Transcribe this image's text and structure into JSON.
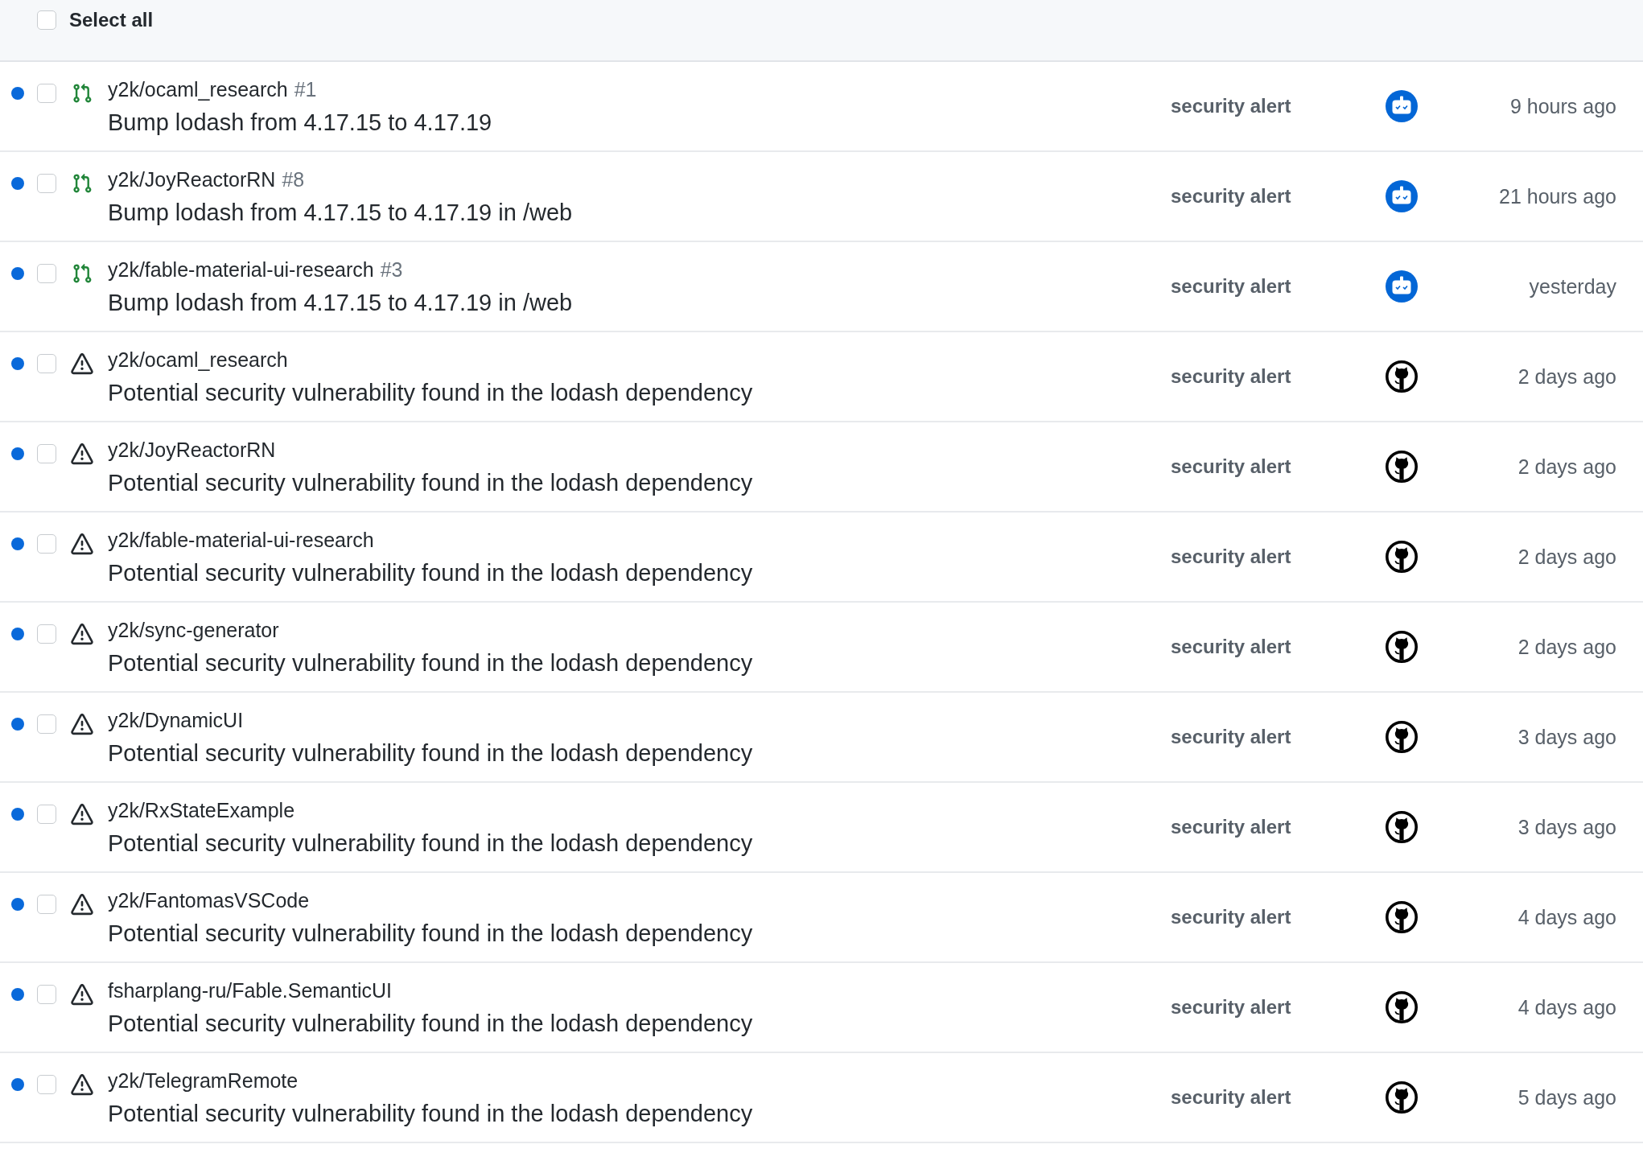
{
  "header": {
    "select_all": {
      "label": "Select all",
      "checked": false
    }
  },
  "notifications": [
    {
      "kind": "pull-request",
      "unread": true,
      "checked": false,
      "repo": "y2k/ocaml_research",
      "number": "#1",
      "title": "Bump lodash from 4.17.15 to 4.17.19",
      "reason": "security alert",
      "avatar": {
        "kind": "robot"
      },
      "time": "9 hours ago"
    },
    {
      "kind": "pull-request",
      "unread": true,
      "checked": false,
      "repo": "y2k/JoyReactorRN",
      "number": "#8",
      "title": "Bump lodash from 4.17.15 to 4.17.19 in /web",
      "reason": "security alert",
      "avatar": {
        "kind": "robot"
      },
      "time": "21 hours ago"
    },
    {
      "kind": "pull-request",
      "unread": true,
      "checked": false,
      "repo": "y2k/fable-material-ui-research",
      "number": "#3",
      "title": "Bump lodash from 4.17.15 to 4.17.19 in /web",
      "reason": "security alert",
      "avatar": {
        "kind": "robot"
      },
      "time": "yesterday"
    },
    {
      "kind": "alert",
      "unread": true,
      "checked": false,
      "repo": "y2k/ocaml_research",
      "title": "Potential security vulnerability found in the lodash dependency",
      "reason": "security alert",
      "avatar": {
        "kind": "cat"
      },
      "time": "2 days ago"
    },
    {
      "kind": "alert",
      "unread": true,
      "checked": false,
      "repo": "y2k/JoyReactorRN",
      "title": "Potential security vulnerability found in the lodash dependency",
      "reason": "security alert",
      "avatar": {
        "kind": "cat"
      },
      "time": "2 days ago"
    },
    {
      "kind": "alert",
      "unread": true,
      "checked": false,
      "repo": "y2k/fable-material-ui-research",
      "title": "Potential security vulnerability found in the lodash dependency",
      "reason": "security alert",
      "avatar": {
        "kind": "cat"
      },
      "time": "2 days ago"
    },
    {
      "kind": "alert",
      "unread": true,
      "checked": false,
      "repo": "y2k/sync-generator",
      "title": "Potential security vulnerability found in the lodash dependency",
      "reason": "security alert",
      "avatar": {
        "kind": "cat"
      },
      "time": "2 days ago"
    },
    {
      "kind": "alert",
      "unread": true,
      "checked": false,
      "repo": "y2k/DynamicUI",
      "title": "Potential security vulnerability found in the lodash dependency",
      "reason": "security alert",
      "avatar": {
        "kind": "cat"
      },
      "time": "3 days ago"
    },
    {
      "kind": "alert",
      "unread": true,
      "checked": false,
      "repo": "y2k/RxStateExample",
      "title": "Potential security vulnerability found in the lodash dependency",
      "reason": "security alert",
      "avatar": {
        "kind": "cat"
      },
      "time": "3 days ago"
    },
    {
      "kind": "alert",
      "unread": true,
      "checked": false,
      "repo": "y2k/FantomasVSCode",
      "title": "Potential security vulnerability found in the lodash dependency",
      "reason": "security alert",
      "avatar": {
        "kind": "cat"
      },
      "time": "4 days ago"
    },
    {
      "kind": "alert",
      "unread": true,
      "checked": false,
      "repo": "fsharplang-ru/Fable.SemanticUI",
      "title": "Potential security vulnerability found in the lodash dependency",
      "reason": "security alert",
      "avatar": {
        "kind": "cat"
      },
      "time": "4 days ago"
    },
    {
      "kind": "alert",
      "unread": true,
      "checked": false,
      "repo": "y2k/TelegramRemote",
      "title": "Potential security vulnerability found in the lodash dependency",
      "reason": "security alert",
      "avatar": {
        "kind": "cat"
      },
      "time": "5 days ago"
    }
  ]
}
